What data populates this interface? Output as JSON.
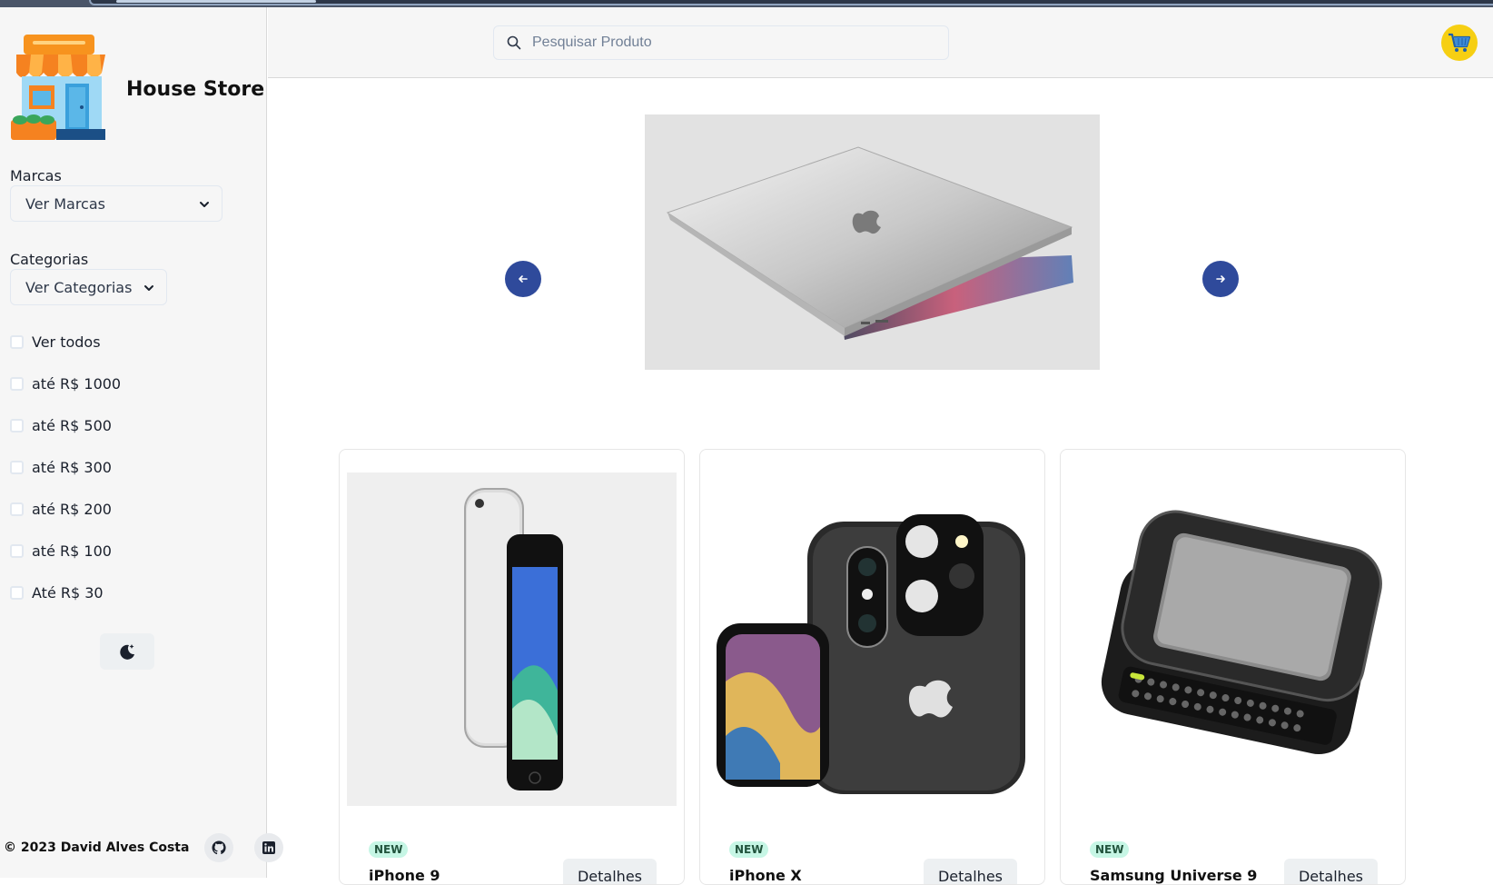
{
  "brand": {
    "title": "House Store"
  },
  "filters": {
    "brands_label": "Marcas",
    "brands_select": "Ver Marcas",
    "categories_label": "Categorias",
    "categories_select": "Ver Categorias",
    "price_options": [
      "Ver todos",
      "até R$ 1000",
      "até R$ 500",
      "até R$ 300",
      "até R$ 200",
      "até R$ 100",
      "Até R$ 30"
    ]
  },
  "footer": {
    "text": "© 2023 David Alves Costa",
    "icons": [
      "github-icon",
      "linkedin-icon"
    ]
  },
  "header": {
    "search_placeholder": "Pesquisar Produto",
    "cart_icon": "cart-icon"
  },
  "carousel": {
    "prev_icon": "arrow-left-icon",
    "next_icon": "arrow-right-icon"
  },
  "products": [
    {
      "title": "iPhone 9",
      "badge": "NEW",
      "button": "Detalhes"
    },
    {
      "title": "iPhone X",
      "badge": "NEW",
      "button": "Detalhes"
    },
    {
      "title": "Samsung Universe 9",
      "badge": "NEW",
      "button": "Detalhes"
    }
  ],
  "colors": {
    "accent": "#2f4a9b",
    "cart": "#f6cf13",
    "badge_bg": "#c6f6e5",
    "badge_text": "#22543d"
  }
}
